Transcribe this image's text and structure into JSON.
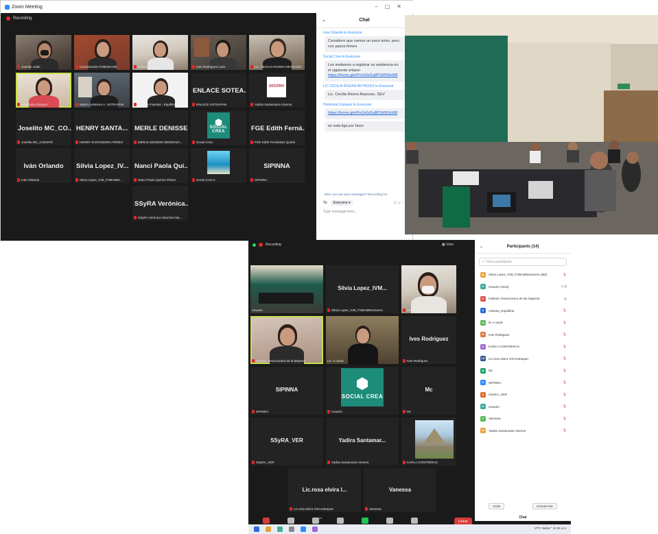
{
  "s1": {
    "title": "Zoom Meeting",
    "recording": "Recording",
    "tiles": [
      {
        "label": "Joselito Jolito",
        "name": ""
      },
      {
        "label": "Coordinación FOBAM-IVM",
        "name": ""
      },
      {
        "label": "Adriana Tecolapa",
        "name": ""
      },
      {
        "label": "Ives Rodríguez León",
        "name": ""
      },
      {
        "label": "Lic. CECILIA RIVERA REYNOSO",
        "name": ""
      },
      {
        "label": "Hortensia Vázquez",
        "name": ""
      },
      {
        "label": "Mayra Ledesma A. SOTEAPAN",
        "name": ""
      },
      {
        "label": "Adriana Fuentes - Equilibria",
        "name": ""
      },
      {
        "label": "ENLACE SOTEAPAN",
        "name": "ENLACE SOTEA..."
      },
      {
        "label": "Yadira Santamaría Viveros",
        "name": "",
        "logo": "DOCPDH"
      },
      {
        "label": "Joselito MC_COESPO",
        "name": "Joselito MC_CO..."
      },
      {
        "label": "HENRY SANTAMARIA PEREZ",
        "name": "HENRY SANTA..."
      },
      {
        "label": "MERLE DENISSE MENDOZA...",
        "name": "MERLE DENISSE..."
      },
      {
        "label": "Social Crea",
        "name": "",
        "logo": "SOCIAL CREA"
      },
      {
        "label": "FGE Edith Fernández Quirós",
        "name": "FGE Edith Ferná..."
      },
      {
        "label": "Iván Orlando",
        "name": "Iván Orlando"
      },
      {
        "label": "Silvia Lopez_IVM_FOBAMM...",
        "name": "Silvia Lopez_IV..."
      },
      {
        "label": "Nanci Paola Quirino Flores",
        "name": "Nanci Paola Qui..."
      },
      {
        "label": "Social Crea 2",
        "name": ""
      },
      {
        "label": "SIPINNA",
        "name": "SIPINNA"
      },
      {
        "label": "SSyRA Verónica Sánchez Ma...",
        "name": "SSyRA Verónica..."
      }
    ],
    "chat": {
      "title": "Chat",
      "messages": [
        {
          "from": "Iván Orlando to Everyone",
          "text": "Considero que vamos un poco lento, pero con pasos firmes"
        },
        {
          "from": "Social Crea to Everyone",
          "text": "Los invitamos a registrar su asistencia en el siguiente enlace:",
          "link": "https://forms.gle/Pm3z6d1q8P1MN3eW8"
        },
        {
          "from": "LIC CECILIA RIVERA REYNOSO to Everyone",
          "text": "Lic. Cecilia Rivera Reynoso. SEV"
        },
        {
          "from": "Hortensia Vázquez to Everyone",
          "text": "",
          "link": "https://forms.gle/Pm3z6d1q8P1MN3eW8"
        },
        {
          "from": "",
          "text": "en esta liga por favor"
        }
      ],
      "who_can_see": "Who can see your messages? Recording On",
      "to_label": "To:",
      "to_value": "Everyone",
      "placeholder": "Type message here..."
    }
  },
  "s3": {
    "recording": "Recording",
    "view": "View",
    "tiles": [
      {
        "label": "Usuario",
        "name": ""
      },
      {
        "label": "Silvia Lopez_IVM_FOBAMMonitoreo",
        "name": "Silvia Lopez_IVM..."
      },
      {
        "label": "Adriana_Equilibria",
        "name": ""
      },
      {
        "label": "Instituto Veracruzano de la Mujeres",
        "name": ""
      },
      {
        "label": "Lic. A.cardo",
        "name": ""
      },
      {
        "label": "Ives Rodriguez",
        "name": "Ives Rodriguez"
      },
      {
        "label": "SIPINNA",
        "name": "SIPINNA"
      },
      {
        "label": "Usuario",
        "name": "",
        "logo": "SOCIAL CREA"
      },
      {
        "label": "Mc",
        "name": "Mc"
      },
      {
        "label": "SSyRA_VER",
        "name": "SSyRA_VER"
      },
      {
        "label": "Yadira Santamaría Viveros",
        "name": "Yadira Santamar..."
      },
      {
        "label": "KARLA CONTRERAS",
        "name": ""
      },
      {
        "label": "Lic.rosa elvira IVM soteapan",
        "name": "Lic.rosa elvira I..."
      },
      {
        "label": "Vanessa",
        "name": "Vanessa"
      }
    ],
    "toolbar": [
      "Audio",
      "Start Video",
      "Participants",
      "Chat",
      "Share Screen",
      "Record",
      "Reactions"
    ],
    "participants_count": "14",
    "leave": "Leave",
    "panel": {
      "title": "Participants (14)",
      "find_placeholder": "Find a participant",
      "participants": [
        {
          "initials": "SL",
          "name": "Silvia Lopez_IVM_FOBAMMonitoreo (Me)",
          "color": "#e8a33b"
        },
        {
          "initials": "U",
          "name": "Usuario (Host)",
          "color": "#3fae9a"
        },
        {
          "initials": "IV",
          "name": "Instituto Veracruzano de las Mujeres",
          "color": "#d9534f"
        },
        {
          "initials": "A",
          "name": "Adriana_Equilibria",
          "color": "#2d6cdf"
        },
        {
          "initials": "LA",
          "name": "lic A cardo",
          "color": "#5cb85c"
        },
        {
          "initials": "IR",
          "name": "Ives Rodriguez",
          "color": "#e07b39"
        },
        {
          "initials": "K",
          "name": "KARLA CONTRERAS",
          "color": "#a06bd6"
        },
        {
          "initials": "LE",
          "name": "Lic.rosa elvira IVM soteapan",
          "color": "#3b5998"
        },
        {
          "initials": "M",
          "name": "Mc",
          "color": "#23a36b"
        },
        {
          "initials": "S",
          "name": "SIPINNA",
          "color": "#2d8cff"
        },
        {
          "initials": "S",
          "name": "SSyRA_VER",
          "color": "#e06a2b"
        },
        {
          "initials": "U",
          "name": "Usuario",
          "color": "#3fae9a"
        },
        {
          "initials": "V",
          "name": "Vanessa",
          "color": "#5cb85c"
        },
        {
          "initials": "YS",
          "name": "Yadira Santamaria Viveros",
          "color": "#e8a33b"
        }
      ],
      "invite": "Invite",
      "unmute_me": "Unmute Me",
      "chat": "Chat"
    },
    "tray": "17ºC Nubla ^ 11:25 a.m."
  }
}
